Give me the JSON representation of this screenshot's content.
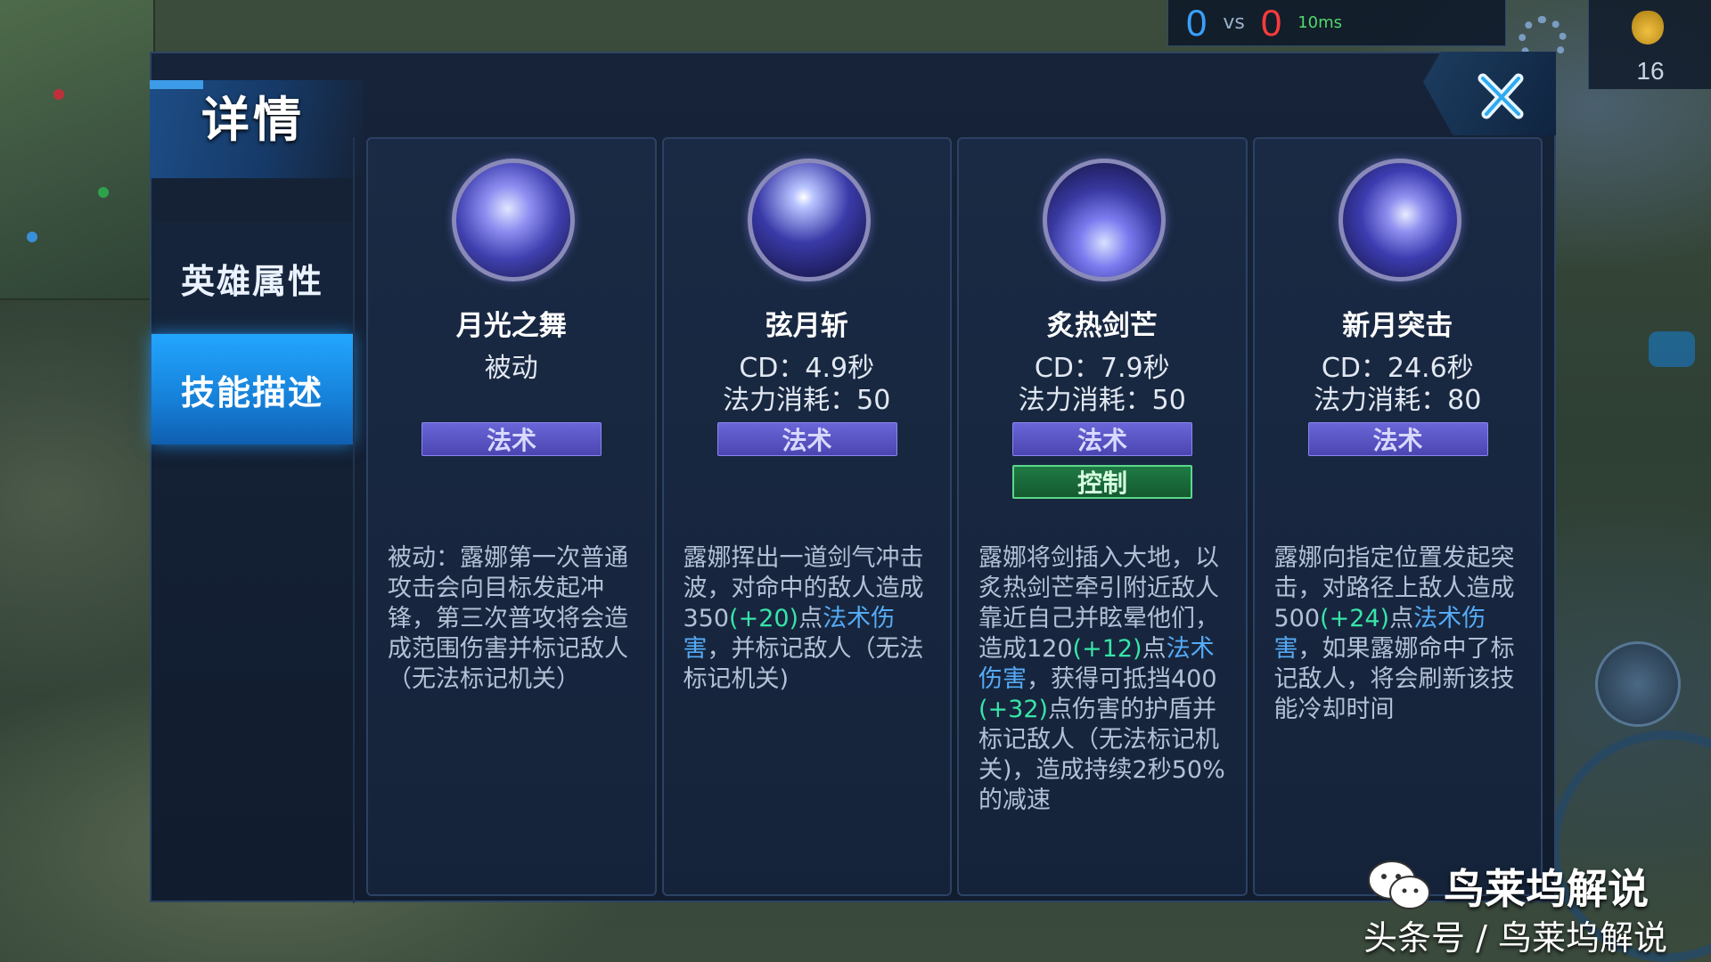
{
  "hud": {
    "score_blue": "0",
    "score_vs": "vs",
    "score_red": "0",
    "ping": "10ms",
    "gold_count": "16"
  },
  "modal": {
    "title": "详情",
    "tabs": [
      {
        "label": "英雄属性",
        "active": false
      },
      {
        "label": "技能描述",
        "active": true
      }
    ]
  },
  "skills": [
    {
      "name": "月光之舞",
      "meta_line1": "被动",
      "meta_line2": "",
      "tags": [
        "法术"
      ],
      "description": [
        {
          "text": "被动：露娜第一次普通攻击会向目标发起冲锋，第三次普攻将会造成范围伤害并标记敌人（无法标记机关）",
          "color": "plain"
        }
      ]
    },
    {
      "name": "弦月斩",
      "meta_line1": "CD：4.9秒",
      "meta_line2": "法力消耗：50",
      "tags": [
        "法术"
      ],
      "description": [
        {
          "text": "露娜挥出一道剑气冲击波，对命中的敌人造成350",
          "color": "plain"
        },
        {
          "text": "(+20)",
          "color": "green"
        },
        {
          "text": "点",
          "color": "plain"
        },
        {
          "text": "法术伤害",
          "color": "blue"
        },
        {
          "text": "，并标记敌人（无法标记机关)",
          "color": "plain"
        }
      ]
    },
    {
      "name": "炙热剑芒",
      "meta_line1": "CD：7.9秒",
      "meta_line2": "法力消耗：50",
      "tags": [
        "法术",
        "控制"
      ],
      "description": [
        {
          "text": "露娜将剑插入大地，以炙热剑芒牵引附近敌人靠近自己并眩晕他们，造成120",
          "color": "plain"
        },
        {
          "text": "(+12)",
          "color": "green"
        },
        {
          "text": "点",
          "color": "plain"
        },
        {
          "text": "法术伤害",
          "color": "blue"
        },
        {
          "text": "，获得可抵挡400",
          "color": "plain"
        },
        {
          "text": "(+32)",
          "color": "green"
        },
        {
          "text": "点伤害的护盾并标记敌人（无法标记机关)，造成持续2秒50%的减速",
          "color": "plain"
        }
      ]
    },
    {
      "name": "新月突击",
      "meta_line1": "CD：24.6秒",
      "meta_line2": "法力消耗：80",
      "tags": [
        "法术"
      ],
      "description": [
        {
          "text": "露娜向指定位置发起突击，对路径上敌人造成500",
          "color": "plain"
        },
        {
          "text": "(+24)",
          "color": "green"
        },
        {
          "text": "点",
          "color": "plain"
        },
        {
          "text": "法术伤害",
          "color": "blue"
        },
        {
          "text": "，如果露娜命中了标记敌人，将会刷新该技能冷却时间",
          "color": "plain"
        }
      ]
    }
  ],
  "watermark": {
    "line1": "鸟莱坞解说",
    "line2": "头条号 / 鸟莱坞解说"
  },
  "colors": {
    "accent_blue": "#1f8fff",
    "magic_tag": "#5450c4",
    "control_tag": "#1a6a3a",
    "value_green": "#38e5a8",
    "magic_damage_blue": "#56aaf5"
  },
  "icons": {
    "close": "close-x-icon",
    "skill1": "moonlight-dance-icon",
    "skill2": "crescent-slash-icon",
    "skill3": "blazing-sword-icon",
    "skill4": "new-moon-strike-icon",
    "watermark": "wechat-icon"
  }
}
